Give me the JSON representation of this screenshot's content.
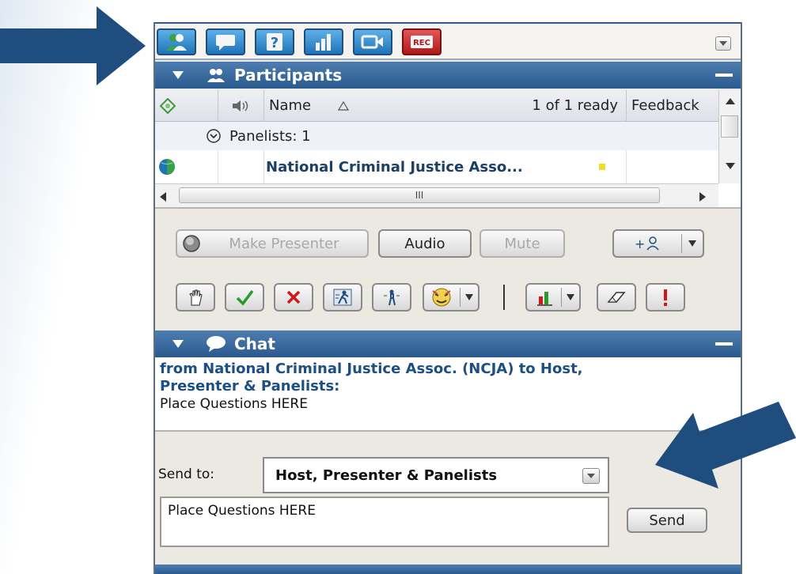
{
  "toolbar": {
    "buttons": [
      {
        "icon": "participants-icon"
      },
      {
        "icon": "chat-icon"
      },
      {
        "icon": "help-icon"
      },
      {
        "icon": "poll-icon"
      },
      {
        "icon": "video-icon"
      },
      {
        "icon": "record-icon",
        "label": "REC"
      }
    ],
    "menu_icon": "dropdown-menu-icon"
  },
  "participants": {
    "title": "Participants",
    "columns": {
      "name": "Name",
      "ready": "1 of 1 ready",
      "feedback": "Feedback"
    },
    "group_label": "Panelists: 1",
    "rows": [
      {
        "name": "National Criminal Justice Asso..."
      }
    ],
    "hscroll_grip": "III",
    "controls": {
      "make_presenter": "Make Presenter",
      "audio": "Audio",
      "mute": "Mute",
      "invite": "+"
    }
  },
  "chat": {
    "title": "Chat",
    "from_line1": "from National Criminal Justice Assoc. (NCJA) to Host,",
    "from_line2": "Presenter & Panelists:",
    "message": "Place Questions HERE",
    "send_to_label": "Send to:",
    "send_to_value": "Host, Presenter & Panelists",
    "input_text": "Place Questions HERE",
    "send_label": "Send"
  },
  "colors": {
    "header_blue": "#2a5a8e",
    "arrow_blue": "#1f4d7d",
    "chat_from": "#1c4f86"
  }
}
